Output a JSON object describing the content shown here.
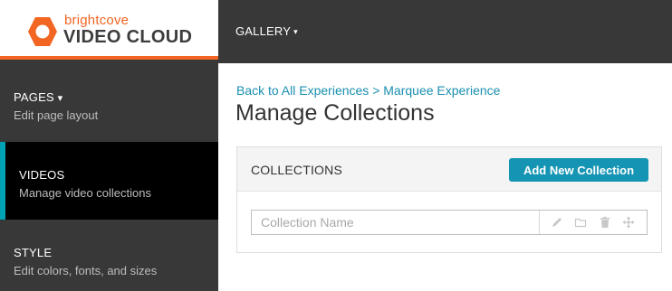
{
  "brand": {
    "small_text": "brightcove",
    "big_text": "VIDEO CLOUD",
    "orange": "#f26522",
    "accent": "#00a2b5"
  },
  "topbar": {
    "gallery_label": "GALLERY",
    "caret": "▾"
  },
  "sidebar": {
    "items": [
      {
        "title": "PAGES",
        "caret": "▾",
        "subtitle": "Edit page layout",
        "active": false
      },
      {
        "title": "VIDEOS",
        "subtitle": "Manage video collections",
        "active": true
      },
      {
        "title": "STYLE",
        "subtitle": "Edit colors, fonts, and sizes",
        "active": false
      }
    ]
  },
  "main": {
    "breadcrumb": {
      "parent": "Back to All Experiences",
      "separator": ">",
      "current": "Marquee Experience"
    },
    "title": "Manage Collections",
    "panel": {
      "title": "COLLECTIONS",
      "add_button": "Add New Collection",
      "row": {
        "placeholder": "Collection Name",
        "icons": [
          "pencil-icon",
          "folder-icon",
          "trash-icon",
          "move-icon"
        ]
      }
    }
  }
}
